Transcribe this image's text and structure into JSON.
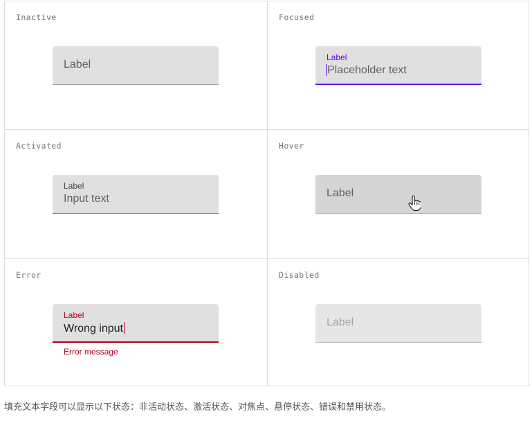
{
  "states": {
    "inactive": {
      "title": "Inactive",
      "label": "Label"
    },
    "focused": {
      "title": "Focused",
      "label": "Label",
      "value": "Placeholder text"
    },
    "activated": {
      "title": "Activated",
      "label": "Label",
      "value": "Input text"
    },
    "hover": {
      "title": "Hover",
      "label": "Label"
    },
    "error": {
      "title": "Error",
      "label": "Label",
      "value": "Wrong input",
      "message": "Error message"
    },
    "disabled": {
      "title": "Disabled",
      "label": "Label"
    }
  },
  "caption": "填充文本字段可以显示以下状态：非活动状态、激活状态、对焦点、悬停状态、错误和禁用状态。",
  "colors": {
    "focus": "#6200ee",
    "error": "#b00020",
    "field_bg": "#e0e0e0"
  },
  "icons": {
    "cursor": "pointer-hand-icon"
  }
}
